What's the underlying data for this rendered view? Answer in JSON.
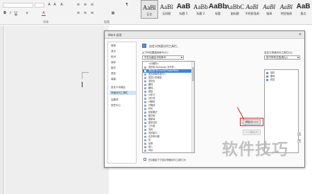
{
  "ribbon": {
    "font_group_label": "字体",
    "paragraph_group_label": "段落",
    "styles": [
      {
        "sample": "AaBl",
        "name": "正文",
        "selected": true
      },
      {
        "sample": "AaBl",
        "name": "无间隔"
      },
      {
        "sample": "AaB",
        "name": "标题 1"
      },
      {
        "sample": "AaBb",
        "name": "标题 2"
      },
      {
        "sample": "AaBb",
        "name": "标题"
      },
      {
        "sample": "AaBbC",
        "name": "副标题"
      },
      {
        "sample": "AaBl",
        "name": "不明显强调"
      },
      {
        "sample": "AaBl",
        "name": "强调"
      },
      {
        "sample": "AaBl",
        "name": "明显强调"
      },
      {
        "sample": "AaB",
        "name": "要点"
      }
    ]
  },
  "dialog": {
    "title": "Word 选项",
    "close_glyph": "×",
    "nav": [
      {
        "label": "常规"
      },
      {
        "label": "显示"
      },
      {
        "label": "校对"
      },
      {
        "label": "保存"
      },
      {
        "label": "版式"
      },
      {
        "label": "语言"
      },
      {
        "label": "高级"
      },
      {
        "label": "自定义功能区"
      },
      {
        "label": "快速访问工具栏",
        "active": true
      },
      {
        "label": "加载项"
      },
      {
        "label": "信任中心"
      }
    ],
    "header_text": "自定义快速访问工具栏。",
    "choose_from_label": "从下列位置选择命令(C):",
    "choose_from_value": "不在功能区中的命令",
    "customize_label": "自定义快速访问工具栏(Q):",
    "customize_value": "用于所有文档(默认)",
    "commands": [
      {
        "label": "<分隔符>"
      },
      {
        "label": "发送到 Exchange 文件夹..."
      },
      {
        "label": "发送到 Microsoft PowerPoint",
        "selected": true
      },
      {
        "label": "发送到邮件收件人"
      },
      {
        "label": "发送以供审阅..."
      },
      {
        "label": "发送至"
      },
      {
        "label": "翻译"
      },
      {
        "label": "翻译..."
      },
      {
        "label": "返回"
      },
      {
        "label": "分布行"
      },
      {
        "label": "分栏符"
      },
      {
        "label": "分隔符"
      },
      {
        "label": "分隔线"
      },
      {
        "label": "符号"
      },
      {
        "label": "复制格式"
      },
      {
        "label": "格式刷"
      },
      {
        "label": "更新域"
      },
      {
        "label": "更多控件"
      },
      {
        "label": "工作表"
      },
      {
        "label": "关闭"
      },
      {
        "label": "关闭窗口"
      },
      {
        "label": "合并单元格"
      },
      {
        "label": "宏"
      },
      {
        "label": "后退"
      },
      {
        "label": "插入"
      },
      {
        "label": "环绕"
      },
      {
        "label": "活动"
      },
      {
        "label": "加载项"
      }
    ],
    "quick_access": [
      {
        "label": "保存"
      },
      {
        "label": "撤消"
      },
      {
        "label": "恢复"
      }
    ],
    "add_button": "添加(A) >>",
    "remove_button": "<< 删除(R)",
    "move_up_glyph": "▲",
    "move_down_glyph": "▼",
    "checkbox_label": "在功能区下方显示快速访问工具栏(H)"
  },
  "annotation": {
    "accent_color": "#e02020"
  },
  "watermark": "软件技巧"
}
